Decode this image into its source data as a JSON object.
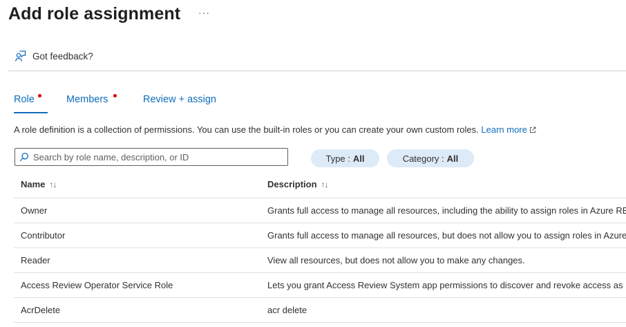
{
  "header": {
    "title": "Add role assignment",
    "more_label": "···",
    "feedback_label": "Got feedback?"
  },
  "tabs": [
    {
      "label": "Role",
      "active": true,
      "required": true
    },
    {
      "label": "Members",
      "active": false,
      "required": true
    },
    {
      "label": "Review + assign",
      "active": false,
      "required": false
    }
  ],
  "description": {
    "text": "A role definition is a collection of permissions. You can use the built-in roles or you can create your own custom roles.",
    "link_label": "Learn more"
  },
  "search": {
    "placeholder": "Search by role name, description, or ID",
    "value": ""
  },
  "filters": {
    "type": {
      "label": "Type :",
      "value": "All"
    },
    "category": {
      "label": "Category :",
      "value": "All"
    }
  },
  "table": {
    "columns": [
      "Name",
      "Description"
    ],
    "rows": [
      {
        "name": "Owner",
        "description": "Grants full access to manage all resources, including the ability to assign roles in Azure RBAC."
      },
      {
        "name": "Contributor",
        "description": "Grants full access to manage all resources, but does not allow you to assign roles in Azure RBAC."
      },
      {
        "name": "Reader",
        "description": "View all resources, but does not allow you to make any changes."
      },
      {
        "name": "Access Review Operator Service Role",
        "description": "Lets you grant Access Review System app permissions to discover and revoke access as needed."
      },
      {
        "name": "AcrDelete",
        "description": "acr delete"
      }
    ]
  },
  "colors": {
    "accent": "#0f6cbd",
    "required_dot": "#e00000",
    "pill_bg": "#ddeaf7",
    "divider": "#e1dfdd"
  },
  "icons": {
    "feedback": "person-feedback-icon",
    "search": "search-icon",
    "external": "external-link-icon",
    "sort": "sort-arrows-icon"
  }
}
